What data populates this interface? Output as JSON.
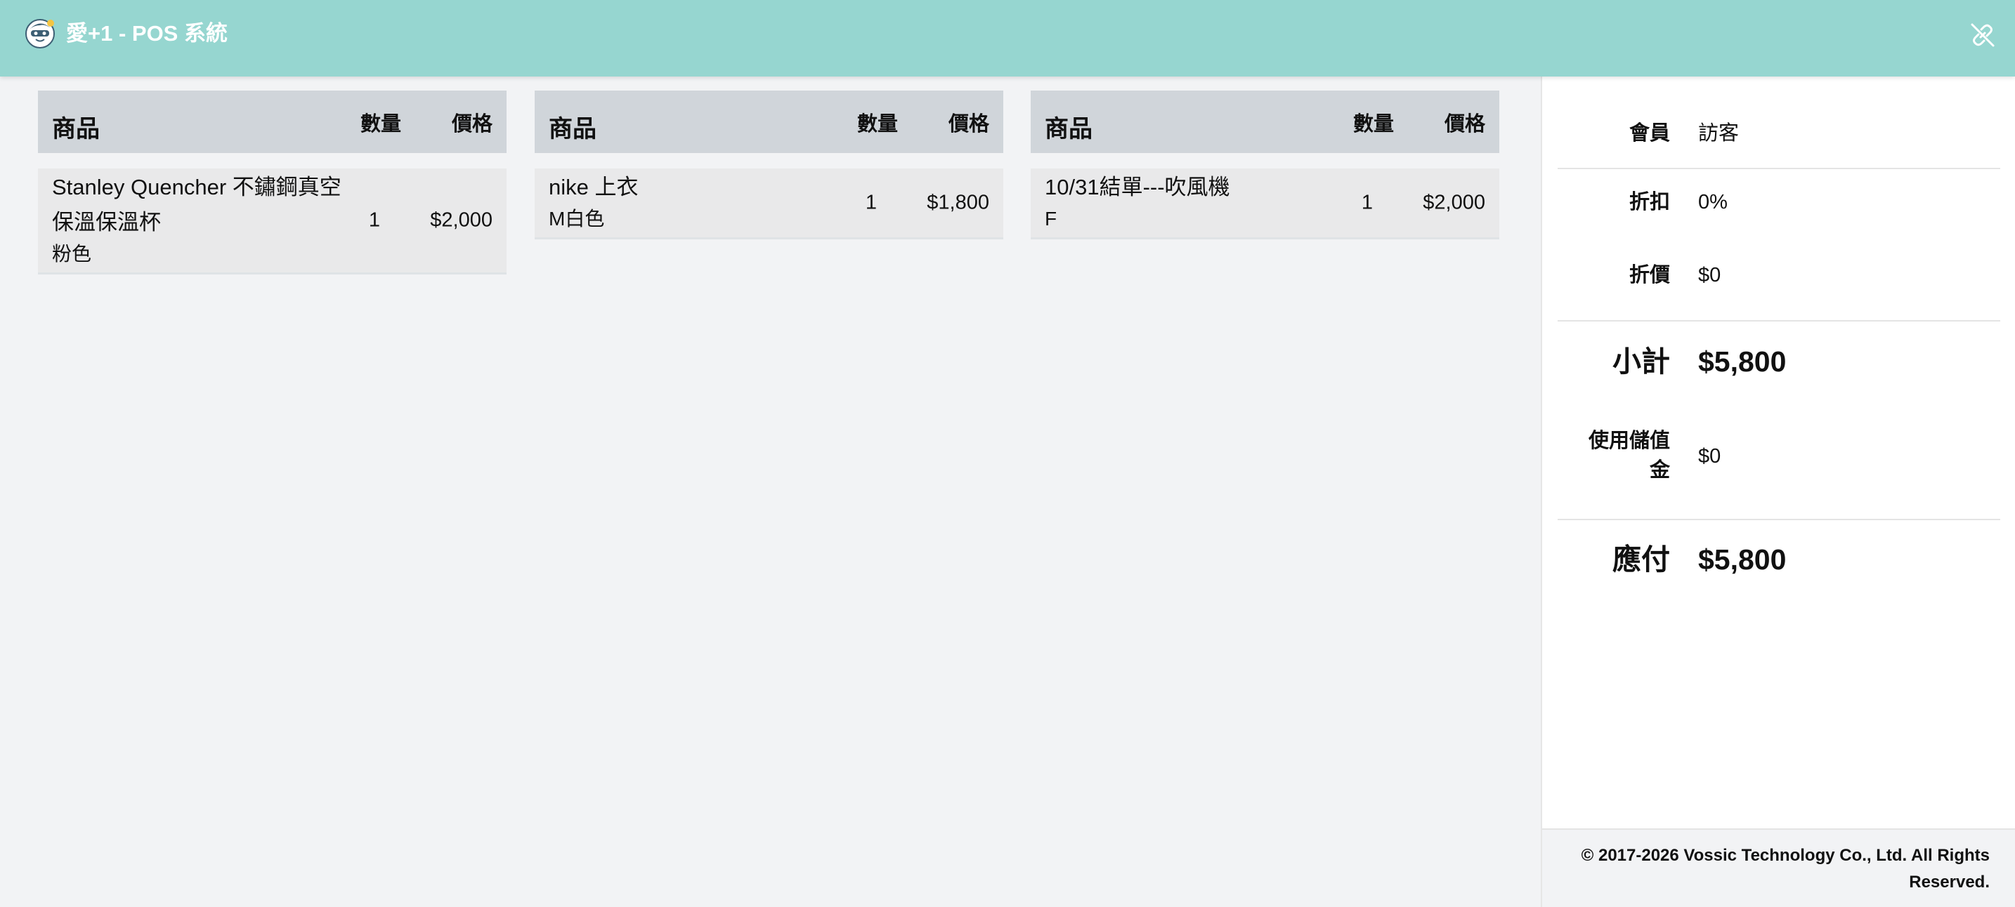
{
  "header": {
    "title": "愛+1 - POS 系統",
    "logo_icon": "mascot-logo-icon",
    "link_status_icon": "link-off-icon",
    "background_color": "#96d6d0"
  },
  "orders": [
    {
      "columns": {
        "product": "商品",
        "qty": "數量",
        "price": "價格"
      },
      "item": {
        "name": "Stanley Quencher 不鏽鋼真空保溫保溫杯",
        "variant": "粉色",
        "qty": "1",
        "price": "$2,000"
      }
    },
    {
      "columns": {
        "product": "商品",
        "qty": "數量",
        "price": "價格"
      },
      "item": {
        "name": "nike 上衣",
        "variant": "M白色",
        "qty": "1",
        "price": "$1,800"
      }
    },
    {
      "columns": {
        "product": "商品",
        "qty": "數量",
        "price": "價格"
      },
      "item": {
        "name": "10/31結單---吹風機",
        "variant": "F",
        "qty": "1",
        "price": "$2,000"
      }
    }
  ],
  "summary": {
    "member_label": "會員",
    "member_value": "訪客",
    "discount_label": "折扣",
    "discount_value": "0%",
    "markdown_label": "折價",
    "markdown_value": "$0",
    "subtotal_label": "小計",
    "subtotal_value": "$5,800",
    "stored_value_label": "使用儲值金",
    "stored_value_value": "$0",
    "payable_label": "應付",
    "payable_value": "$5,800"
  },
  "footer": {
    "copyright": "© 2017-2026 Vossic Technology Co., Ltd. All Rights Reserved."
  }
}
